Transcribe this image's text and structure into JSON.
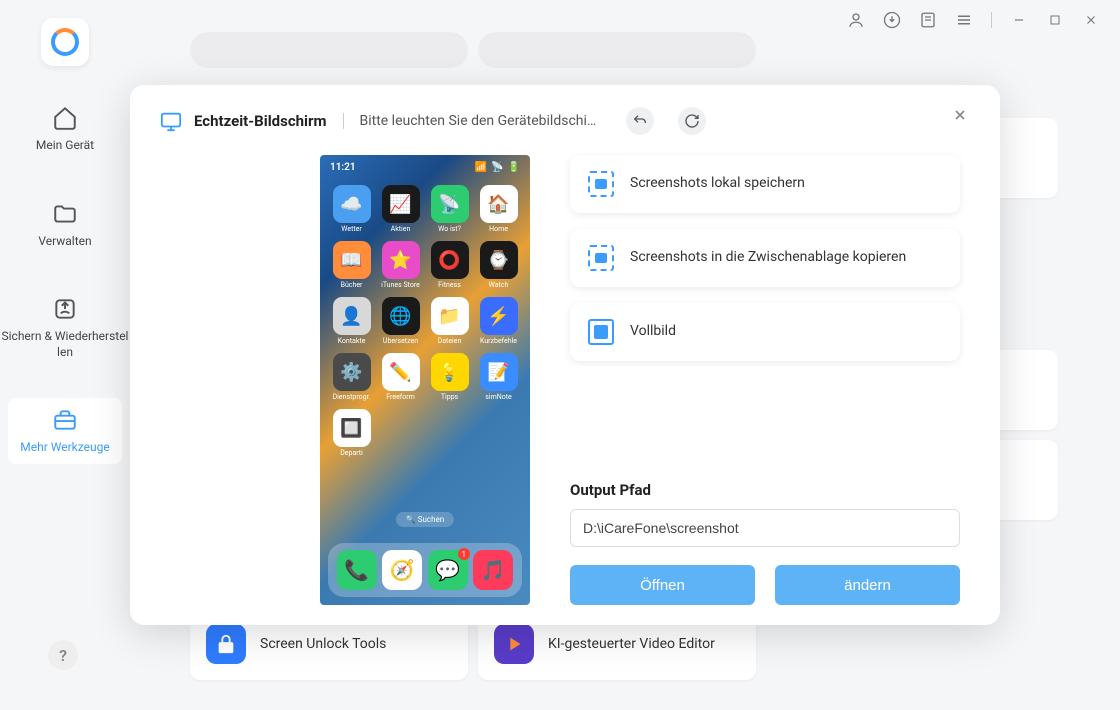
{
  "titlebar": {
    "icons": [
      "user",
      "download",
      "changelog",
      "menu",
      "minimize",
      "maximize",
      "close"
    ]
  },
  "sidebar": {
    "items": [
      {
        "label": "Mein Gerät",
        "icon": "home"
      },
      {
        "label": "Verwalten",
        "icon": "folder"
      },
      {
        "label": "Sichern & Wiederherstel\nlen",
        "icon": "backup"
      },
      {
        "label": "Mehr Werkzeuge",
        "icon": "toolbox"
      }
    ],
    "active_index": 3,
    "help_label": "?"
  },
  "background_tools": [
    {
      "label": "Screen Unlock Tools",
      "color": "#2f7cff"
    },
    {
      "label": "KI-gesteuerter Video Editor",
      "color": "#5a3cc8"
    }
  ],
  "modal": {
    "title": "Echtzeit-Bildschirm",
    "subtitle": "Bitte leuchten Sie den Gerätebildschi…",
    "options": [
      {
        "label": "Screenshots lokal speichern",
        "icon": "save-local"
      },
      {
        "label": "Screenshots in die Zwischenablage kopieren",
        "icon": "copy-clip"
      },
      {
        "label": "Vollbild",
        "icon": "fullscreen"
      }
    ],
    "output": {
      "label": "Output Pfad",
      "path": "D:\\iCareFone\\screenshot",
      "open_label": "Öffnen",
      "change_label": "ändern"
    },
    "phone": {
      "time": "11:21",
      "search": "🔍 Suchen",
      "apps": [
        {
          "label": "Wetter",
          "bg": "#4a9ff0",
          "emoji": "☁️"
        },
        {
          "label": "Aktien",
          "bg": "#1a1a1a",
          "emoji": "📈"
        },
        {
          "label": "Wo ist?",
          "bg": "#2ecc71",
          "emoji": "📡"
        },
        {
          "label": "Home",
          "bg": "#ffffff",
          "emoji": "🏠"
        },
        {
          "label": "Bücher",
          "bg": "#ff8d3a",
          "emoji": "📖"
        },
        {
          "label": "iTunes Store",
          "bg": "#e84cc8",
          "emoji": "⭐"
        },
        {
          "label": "Fitness",
          "bg": "#1a1a1a",
          "emoji": "⭕"
        },
        {
          "label": "Watch",
          "bg": "#1a1a1a",
          "emoji": "⌚"
        },
        {
          "label": "Kontakte",
          "bg": "#d8d8d8",
          "emoji": "👤"
        },
        {
          "label": "Übersetzen",
          "bg": "#1a1a1a",
          "emoji": "🌐"
        },
        {
          "label": "Dateien",
          "bg": "#ffffff",
          "emoji": "📁"
        },
        {
          "label": "Kurzbefehle",
          "bg": "#3a6cff",
          "emoji": "⚡"
        },
        {
          "label": "Dienstprogr.",
          "bg": "#4a4a4a",
          "emoji": "⚙️"
        },
        {
          "label": "Freeform",
          "bg": "#ffffff",
          "emoji": "✏️"
        },
        {
          "label": "Tipps",
          "bg": "#ffd700",
          "emoji": "💡"
        },
        {
          "label": "simNote",
          "bg": "#3a8cff",
          "emoji": "📝"
        },
        {
          "label": "Departi",
          "bg": "#ffffff",
          "emoji": "🔲"
        }
      ],
      "dock": [
        {
          "bg": "#2ecc71",
          "emoji": "📞"
        },
        {
          "bg": "#ffffff",
          "emoji": "🧭"
        },
        {
          "bg": "#2ecc71",
          "emoji": "💬",
          "badge": "1"
        },
        {
          "bg": "#ff3b5c",
          "emoji": "🎵"
        }
      ]
    }
  }
}
